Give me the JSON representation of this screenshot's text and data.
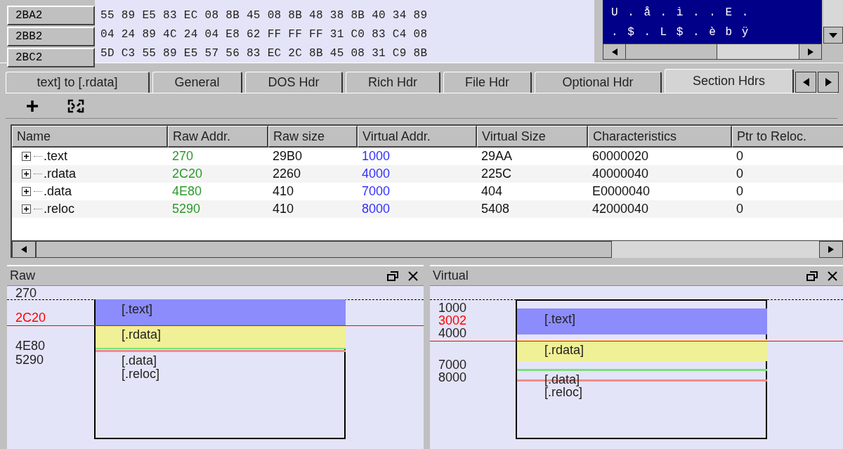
{
  "hex_view": {
    "rows": [
      {
        "offset": "2BA2",
        "bytes": "55 89 E5 83 EC 08 8B 45 08 8B 48 38 8B 40 34 89",
        "ascii": "U . å . ì . . E ."
      },
      {
        "offset": "2BB2",
        "bytes": "04 24 89 4C 24 04 E8 62 FF FF FF 31 C0 83 C4 08",
        "ascii": ". $ . L $ . è b ÿ"
      },
      {
        "offset": "2BC2",
        "bytes": "5D C3 55 89 E5 57 56 83 EC 2C 8B 45 08 31 C9 8B"
      }
    ]
  },
  "tabs": [
    {
      "label": "text] to [.rdata]",
      "selected": false
    },
    {
      "label": "General",
      "selected": false
    },
    {
      "label": "DOS Hdr",
      "selected": false
    },
    {
      "label": "Rich Hdr",
      "selected": false
    },
    {
      "label": "File Hdr",
      "selected": false
    },
    {
      "label": "Optional Hdr",
      "selected": false
    },
    {
      "label": "Section Hdrs",
      "selected": true
    }
  ],
  "sections_table": {
    "columns": [
      "Name",
      "Raw Addr.",
      "Raw size",
      "Virtual Addr.",
      "Virtual Size",
      "Characteristics",
      "Ptr to Reloc."
    ],
    "rows": [
      {
        "name": ".text",
        "raw_addr": "270",
        "raw_size": "29B0",
        "virtual_addr": "1000",
        "virtual_size": "29AA",
        "characteristics": "60000020",
        "ptr_to_reloc": "0",
        "expanded": false
      },
      {
        "name": ".rdata",
        "raw_addr": "2C20",
        "raw_size": "2260",
        "virtual_addr": "4000",
        "virtual_size": "225C",
        "characteristics": "40000040",
        "ptr_to_reloc": "0",
        "expanded": false
      },
      {
        "name": ".data",
        "raw_addr": "4E80",
        "raw_size": "410",
        "virtual_addr": "7000",
        "virtual_size": "404",
        "characteristics": "E0000040",
        "ptr_to_reloc": "0",
        "expanded": false
      },
      {
        "name": ".reloc",
        "raw_addr": "5290",
        "raw_size": "410",
        "virtual_addr": "8000",
        "virtual_size": "5408",
        "characteristics": "42000040",
        "ptr_to_reloc": "0",
        "expanded": false
      }
    ]
  },
  "panels": [
    {
      "title": "Raw",
      "axis_labels": [
        {
          "text": "270",
          "kind": "address"
        },
        {
          "text": "2C20",
          "kind": "marker"
        },
        {
          "text": "4E80",
          "kind": "address"
        },
        {
          "text": "5290",
          "kind": "address"
        }
      ],
      "blocks": [
        {
          "label": "[.text]",
          "color": "#8c8cfc"
        },
        {
          "label": "[.rdata]",
          "color": "#f0f096"
        },
        {
          "label": "[.data]",
          "color": "#7ce07c"
        },
        {
          "label": "[.reloc]",
          "color": "#f08c8c"
        }
      ]
    },
    {
      "title": "Virtual",
      "axis_labels": [
        {
          "text": "1000",
          "kind": "address"
        },
        {
          "text": "3002",
          "kind": "marker"
        },
        {
          "text": "4000",
          "kind": "address"
        },
        {
          "text": "7000",
          "kind": "address"
        },
        {
          "text": "8000",
          "kind": "address"
        }
      ],
      "blocks": [
        {
          "label": "[.text]",
          "color": "#8c8cfc"
        },
        {
          "label": "[.rdata]",
          "color": "#f0f096"
        },
        {
          "label": "[.data]",
          "color": "#7ce07c"
        },
        {
          "label": "[.reloc]",
          "color": "#f08c8c"
        }
      ]
    }
  ]
}
